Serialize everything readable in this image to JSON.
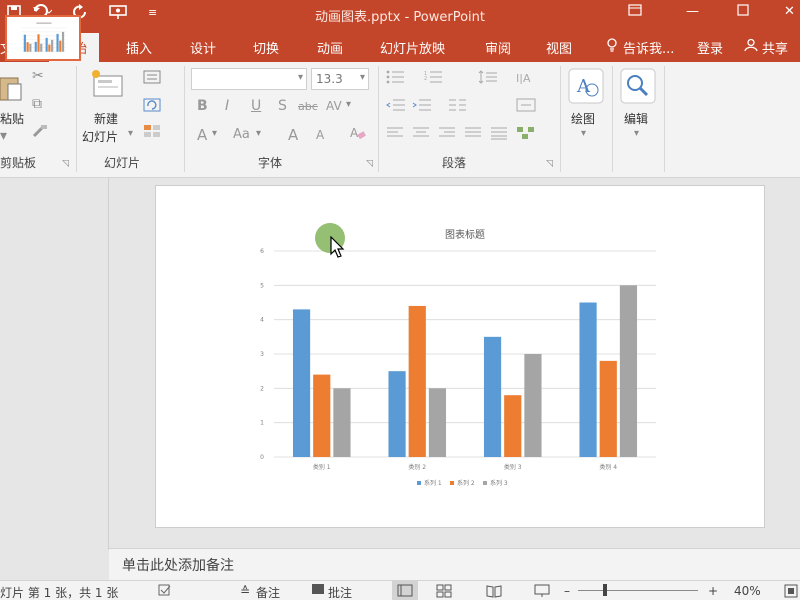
{
  "window": {
    "title": "动画图表.pptx - PowerPoint",
    "minimize_icon": "restore-icon",
    "restore_icon": "window-icon"
  },
  "ribbon_tabs": {
    "file": "文件",
    "home": "开始",
    "insert": "插入",
    "design": "设计",
    "transitions": "切换",
    "animations": "动画",
    "slideshow": "幻灯片放映",
    "review": "审阅",
    "view": "视图",
    "tell_me": "告诉我...",
    "sign_in": "登录",
    "share": "共享"
  },
  "ribbon": {
    "clipboard": {
      "paste_label": "粘贴",
      "group_label": "剪贴板"
    },
    "slides": {
      "new_slide_label": "新建",
      "new_slide_label2": "幻灯片",
      "group_label": "幻灯片"
    },
    "font": {
      "font_name_value": "",
      "font_size_value": "13.3",
      "bold": "B",
      "italic": "I",
      "underline": "U",
      "shadow": "S",
      "strike": "abc",
      "spacing": "AV",
      "font_color": "A",
      "font_case": "Aa",
      "grow": "A",
      "shrink": "A",
      "group_label": "字体"
    },
    "paragraph": {
      "group_label": "段落"
    },
    "drawing": {
      "label": "绘图"
    },
    "editing": {
      "label": "编辑"
    }
  },
  "notes": {
    "placeholder": "单击此处添加备注"
  },
  "statusbar": {
    "slide_info": "灯片 第 1 张，共 1 张",
    "notes_label": "备注",
    "comments_label": "批注",
    "zoom_minus": "–",
    "zoom_plus": "+",
    "zoom_value": "40%"
  },
  "colors": {
    "accent": "#c4462a",
    "series1": "#5b9bd5",
    "series2": "#ed7d31",
    "series3": "#a5a5a5"
  },
  "chart_data": {
    "type": "bar",
    "title": "图表标题",
    "categories": [
      "类别 1",
      "类别 2",
      "类别 3",
      "类别 4"
    ],
    "series": [
      {
        "name": "系列 1",
        "values": [
          4.3,
          2.5,
          3.5,
          4.5
        ]
      },
      {
        "name": "系列 2",
        "values": [
          2.4,
          4.4,
          1.8,
          2.8
        ]
      },
      {
        "name": "系列 3",
        "values": [
          2,
          2,
          3,
          5
        ]
      }
    ],
    "ylim": [
      0,
      6
    ],
    "yticks": [
      "0",
      "1",
      "2",
      "3",
      "4",
      "5",
      "6"
    ],
    "grid": true,
    "legend": "bottom"
  }
}
